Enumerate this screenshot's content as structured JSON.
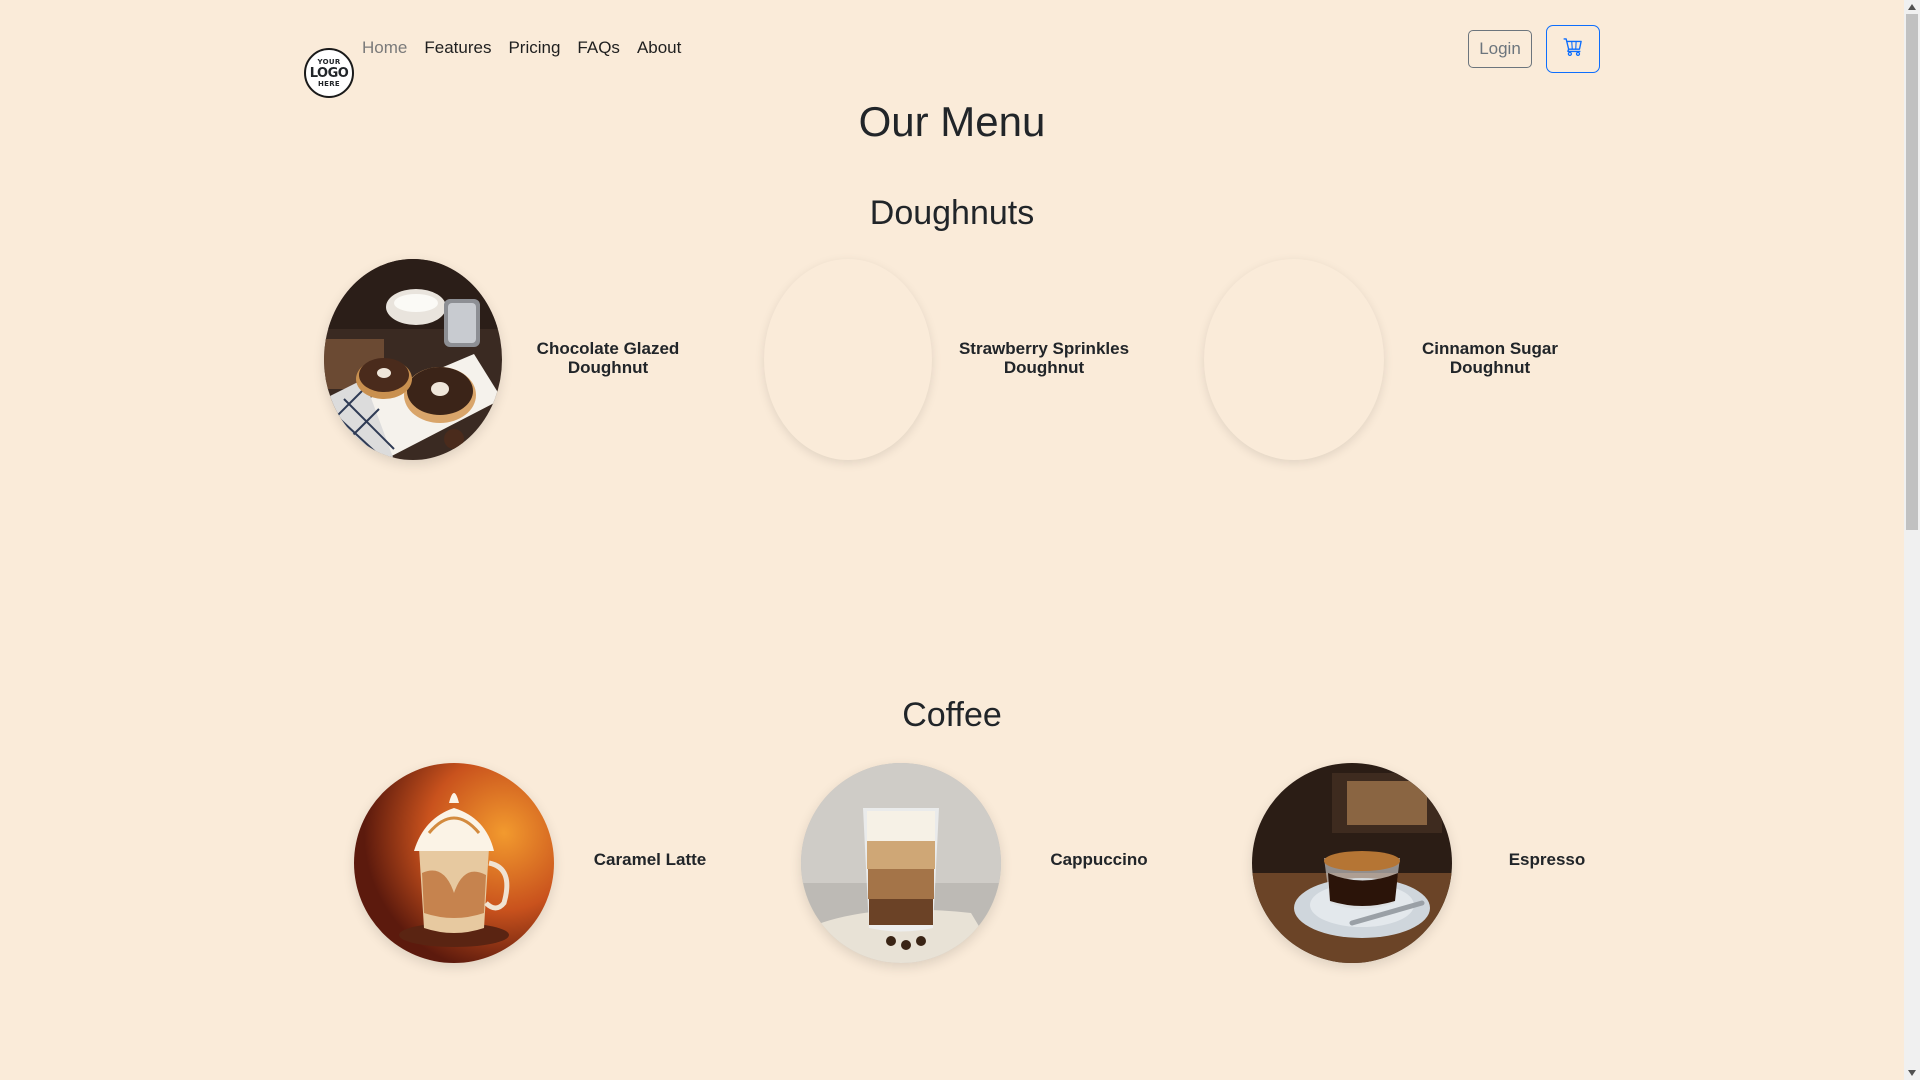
{
  "logo": {
    "line1": "YOUR",
    "line2": "LOGO",
    "line3": "HERE"
  },
  "nav": {
    "items": [
      {
        "label": "Home",
        "active": true
      },
      {
        "label": "Features",
        "active": false
      },
      {
        "label": "Pricing",
        "active": false
      },
      {
        "label": "FAQs",
        "active": false
      },
      {
        "label": "About",
        "active": false
      }
    ],
    "login_label": "Login",
    "cart_icon": "cart-icon"
  },
  "menu": {
    "title": "Our Menu",
    "sections": [
      {
        "title": "Doughnuts",
        "items": [
          {
            "label_line1": "Chocolate Glazed",
            "label_line2": "Doughnut",
            "image": "chocolate-doughnut-photo"
          },
          {
            "label_line1": "Strawberry Sprinkles",
            "label_line2": "Doughnut",
            "image": "strawberry-doughnut-photo-blank"
          },
          {
            "label_line1": "Cinnamon Sugar",
            "label_line2": "Doughnut",
            "image": "cinnamon-doughnut-photo-blank"
          }
        ]
      },
      {
        "title": "Coffee",
        "items": [
          {
            "label_line1": "Caramel Latte",
            "image": "caramel-latte-photo"
          },
          {
            "label_line1": "Cappuccino",
            "image": "cappuccino-photo"
          },
          {
            "label_line1": "Espresso",
            "image": "espresso-photo"
          }
        ]
      }
    ]
  },
  "colors": {
    "background": "#faebd9",
    "text": "#212529",
    "login_border": "#6c757d",
    "cart_border": "#0d6efd"
  }
}
